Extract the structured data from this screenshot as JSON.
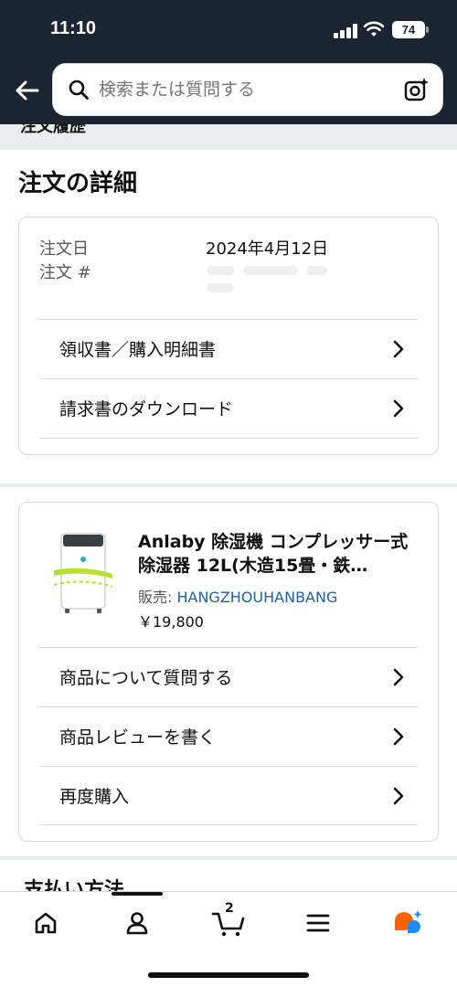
{
  "status_bar": {
    "time": "11:10",
    "battery": "74"
  },
  "search": {
    "placeholder": "検索または質問する"
  },
  "breadcrumb": {
    "text": "注文履歴"
  },
  "page": {
    "title": "注文の詳細"
  },
  "order_info": {
    "date_label": "注文日",
    "date_value": "2024年4月12日",
    "number_label": "注文 #"
  },
  "order_links": [
    {
      "label": "領収書／購入明細書"
    },
    {
      "label": "請求書のダウンロード"
    }
  ],
  "product": {
    "title": "Anlaby 除湿機 コンプレッサー式 除湿器 12L(木造15畳・鉄…",
    "seller_label": "販売: ",
    "seller_name": "HANGZHOUHANBANG",
    "price": "￥19,800"
  },
  "product_links": [
    {
      "label": "商品について質問する"
    },
    {
      "label": "商品レビューを書く"
    },
    {
      "label": "再度購入"
    }
  ],
  "payment": {
    "title": "支払い方法"
  },
  "bottom_nav": {
    "cart_count": "2",
    "items": [
      "home-icon",
      "account-icon",
      "cart-icon",
      "menu-icon",
      "rufus-icon"
    ]
  },
  "colors": {
    "header_bg": "#1b2431",
    "link": "#2162a1",
    "accent_orange": "#ff6200",
    "accent_blue": "#1a8cff"
  }
}
